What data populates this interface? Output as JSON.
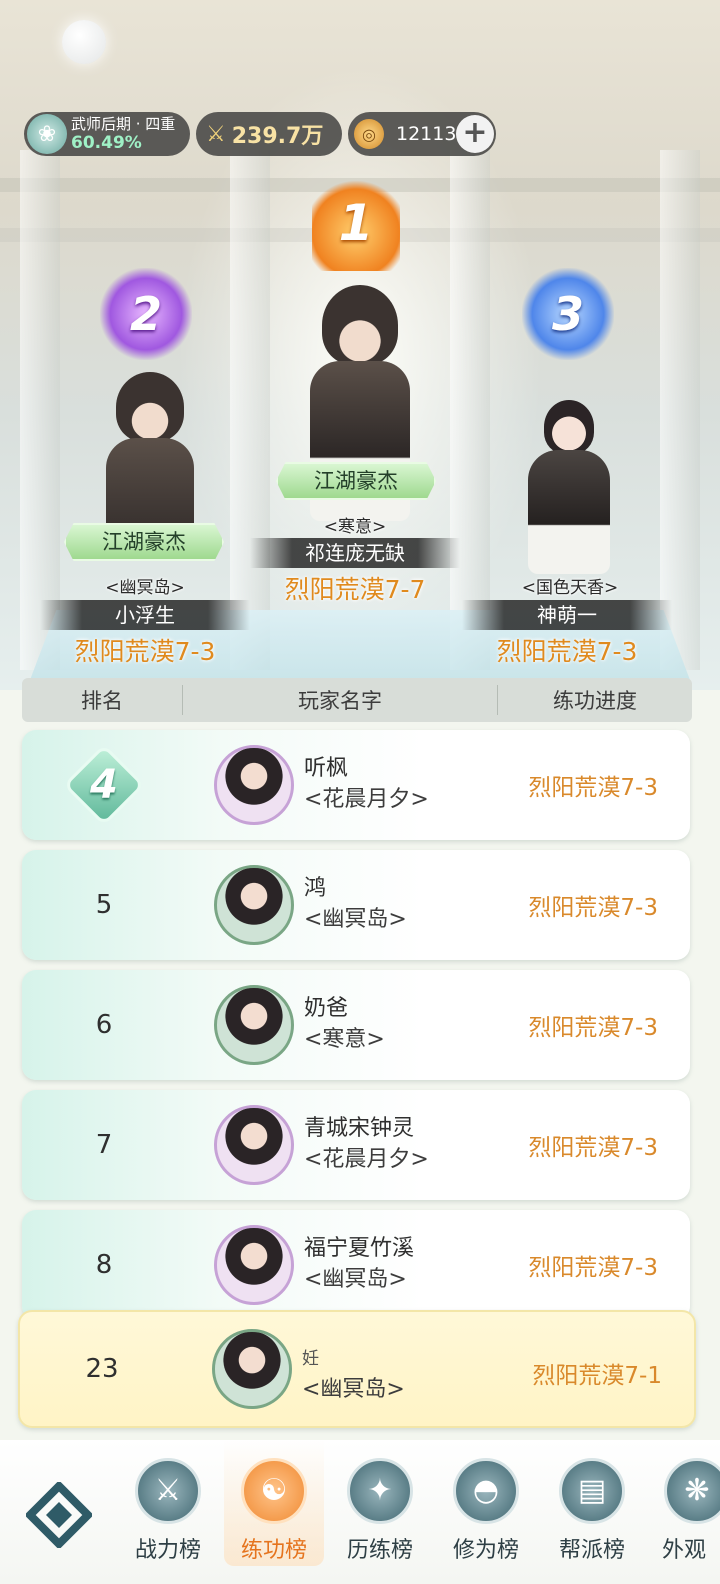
{
  "hud": {
    "rank_title": "武师后期 · 四重",
    "rank_percent": "60.49%",
    "power": "239.7万",
    "currency": "12113",
    "plus": "+"
  },
  "podium": [
    {
      "place": "1",
      "title": "江湖豪杰",
      "guild": "<寒意>",
      "name": "祁连庞无缺",
      "progress": "烈阳荒漠7-7"
    },
    {
      "place": "2",
      "title": "江湖豪杰",
      "guild": "<幽冥岛>",
      "name": "小浮生",
      "progress": "烈阳荒漠7-3"
    },
    {
      "place": "3",
      "title": "",
      "guild": "<国色天香>",
      "name": "神萌一",
      "progress": "烈阳荒漠7-3"
    }
  ],
  "table": {
    "headers": [
      "排名",
      "玩家名字",
      "练功进度"
    ],
    "rows": [
      {
        "rank": "4",
        "name": "听枫",
        "guild": "<花晨月夕>",
        "progress": "烈阳荒漠7-3"
      },
      {
        "rank": "5",
        "name": "鸿",
        "guild": "<幽冥岛>",
        "progress": "烈阳荒漠7-3"
      },
      {
        "rank": "6",
        "name": "奶爸",
        "guild": "<寒意>",
        "progress": "烈阳荒漠7-3"
      },
      {
        "rank": "7",
        "name": "青城宋钟灵",
        "guild": "<花晨月夕>",
        "progress": "烈阳荒漠7-3"
      },
      {
        "rank": "8",
        "name": "福宁夏竹溪",
        "guild": "<幽冥岛>",
        "progress": "烈阳荒漠7-3"
      }
    ],
    "me": {
      "rank": "23",
      "name": "妊",
      "guild": "<幽冥岛>",
      "progress": "烈阳荒漠7-1"
    }
  },
  "nav": {
    "items": [
      {
        "label": "战力榜",
        "icon": "crossed-swords-icon"
      },
      {
        "label": "练功榜",
        "icon": "yin-yang-icon"
      },
      {
        "label": "历练榜",
        "icon": "compass-star-icon"
      },
      {
        "label": "修为榜",
        "icon": "hat-icon"
      },
      {
        "label": "帮派榜",
        "icon": "scroll-icon"
      },
      {
        "label": "外观",
        "icon": "fan-icon"
      }
    ],
    "active": "练功榜"
  },
  "colors": {
    "progress": "#d9892b",
    "active_tab": "#e5741e",
    "rank4_badge": "#5fb89a",
    "self_row": "#fff4c6"
  }
}
